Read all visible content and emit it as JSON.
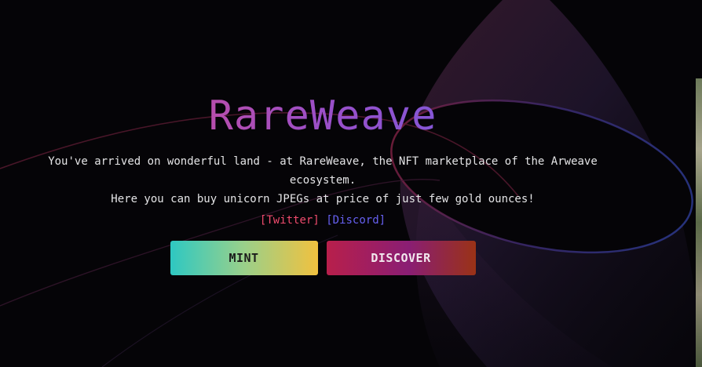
{
  "brand": {
    "title": "RareWeave"
  },
  "hero": {
    "description_line1": "You've arrived on wonderful land - at RareWeave, the NFT marketplace of the Arweave ecosystem.",
    "description_line2": "Here you can buy unicorn JPEGs at price of just few gold ounces!"
  },
  "links": {
    "twitter_label": "[Twitter]",
    "discord_label": "[Discord]"
  },
  "actions": {
    "mint_label": "MINT",
    "discover_label": "DISCOVER"
  },
  "colors": {
    "background": "#050407",
    "title_gradient_start": "#ea4b79",
    "title_gradient_end": "#5b63ee",
    "twitter_link": "#ef4b6d",
    "discord_link": "#6660f0",
    "mint_gradient_start": "#2ec8c2",
    "mint_gradient_end": "#f1c13f",
    "discover_gradient_start": "#b81f4b",
    "discover_gradient_end": "#9a3216"
  }
}
